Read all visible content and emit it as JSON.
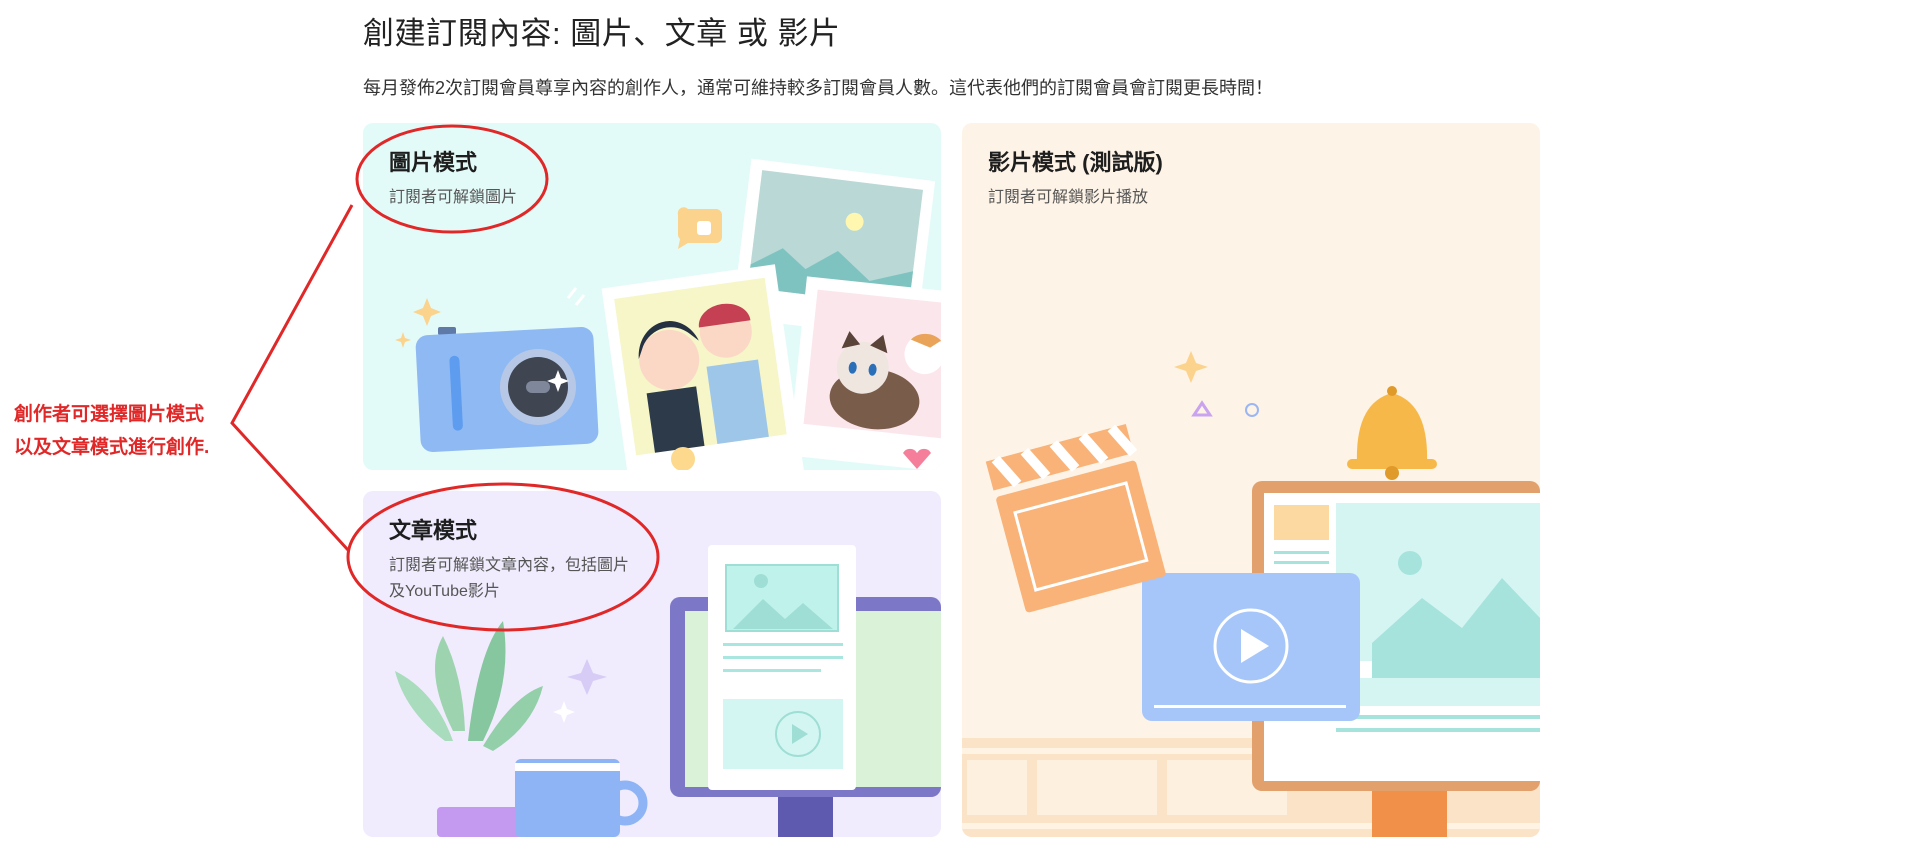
{
  "header": {
    "title": "創建訂閱內容: 圖片、文章 或 影片",
    "description": "每月發佈2次訂閱會員尊享內容的創作人，通常可維持較多訂閱會員人數。這代表他們的訂閱會員會訂閱更長時間！"
  },
  "modes": {
    "photo": {
      "title": "圖片模式",
      "subtitle": "訂閱者可解鎖圖片"
    },
    "article": {
      "title": "文章模式",
      "subtitle_line1": "訂閱者可解鎖文章內容，包括圖片",
      "subtitle_line2": "及YouTube影片"
    },
    "video": {
      "title": "影片模式 (測試版)",
      "subtitle": "訂閱者可解鎖影片播放"
    }
  },
  "annotation": {
    "line1": "創作者可選擇圖片模式",
    "line2": "以及文章模式進行創作.",
    "color": "#e02828"
  },
  "colors": {
    "photo_bg": "#e3fbf8",
    "article_bg": "#f0ecfd",
    "video_bg": "#fdf3e6"
  }
}
